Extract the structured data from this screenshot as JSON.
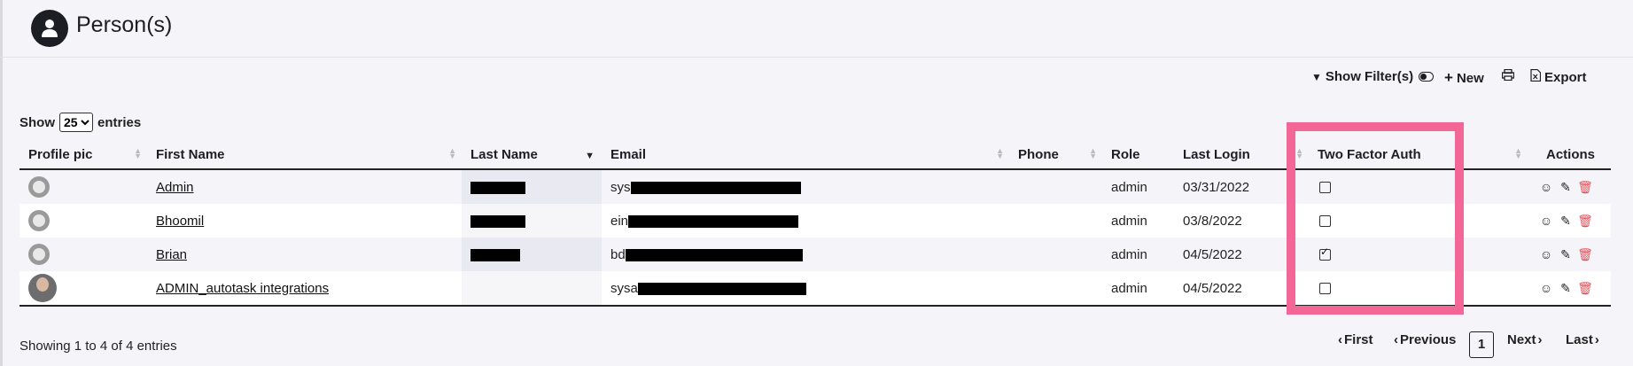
{
  "header": {
    "title": "Person(s)",
    "icon": "user-icon"
  },
  "toolbar": {
    "show_filters": "Show Filter(s)",
    "new": "New",
    "export": "Export",
    "icons": {
      "filter": "filter-icon",
      "toggle": "toggle-icon",
      "plus": "plus-icon",
      "print": "print-icon",
      "export": "excel-icon"
    }
  },
  "entries": {
    "show_label": "Show",
    "selected": "25",
    "entries_label": "entries"
  },
  "table": {
    "columns": [
      "Profile pic",
      "First Name",
      "Last Name",
      "Email",
      "Phone",
      "Role",
      "Last Login",
      "Two Factor Auth",
      "Actions"
    ],
    "sorted_column": "Last Name",
    "rows": [
      {
        "first_name": "Admin",
        "email_prefix": "sys",
        "phone": "",
        "role": "admin",
        "last_login": "03/31/2022",
        "two_factor": false
      },
      {
        "first_name": "Bhoomil",
        "email_prefix": "ein",
        "phone": "",
        "role": "admin",
        "last_login": "03/8/2022",
        "two_factor": false
      },
      {
        "first_name": "Brian",
        "email_prefix": "bd",
        "phone": "",
        "role": "admin",
        "last_login": "04/5/2022",
        "two_factor": true
      },
      {
        "first_name": "ADMIN_autotask integrations",
        "email_prefix": "sysa",
        "phone": "",
        "role": "admin",
        "last_login": "04/5/2022",
        "two_factor": false
      }
    ]
  },
  "footer": {
    "showing": "Showing 1 to 4 of 4 entries",
    "first": "First",
    "previous": "Previous",
    "current_page": "1",
    "next": "Next",
    "last": "Last"
  },
  "colors": {
    "highlight": "#f26795",
    "delete": "#e0505a",
    "header_icon_bg": "#1d1d24"
  }
}
